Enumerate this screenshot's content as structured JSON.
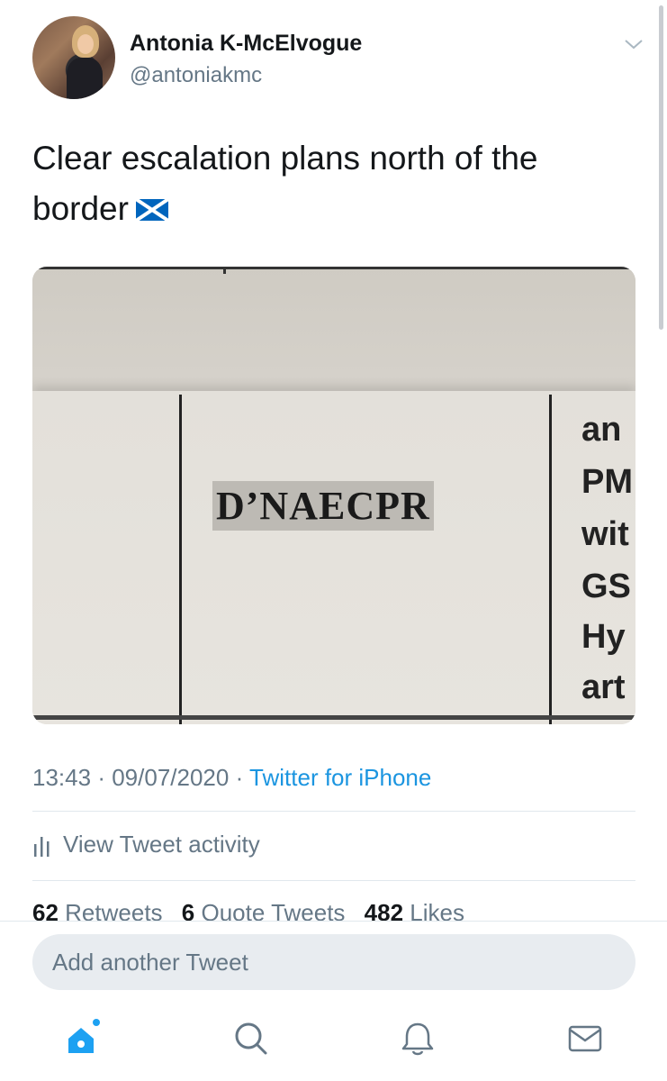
{
  "author": {
    "name": "Antonia K-McElvogue",
    "handle": "@antoniakmc"
  },
  "tweet": {
    "text": "Clear escalation plans north of the border",
    "flag_icon": "scotland-flag-icon",
    "photo": {
      "code_label": "D’NAECPR",
      "side_fragments": [
        "an",
        "PM",
        "wit",
        "GS",
        "Hy",
        "art"
      ]
    }
  },
  "meta": {
    "time": "13:43",
    "sep": "·",
    "date": "09/07/2020",
    "source": "Twitter for iPhone"
  },
  "activity": {
    "label": "View Tweet activity",
    "icon": "bar-chart-icon"
  },
  "stats": {
    "retweets_count": "62",
    "retweets_label": "Retweets",
    "quotes_count": "6",
    "quotes_label": "Quote Tweets",
    "likes_count": "482",
    "likes_label": "Likes"
  },
  "reply": {
    "placeholder": "Add another Tweet"
  },
  "tabbar": {
    "items": [
      "home-icon",
      "search-icon",
      "notifications-icon",
      "messages-icon"
    ],
    "accent": "#1da1f2"
  }
}
